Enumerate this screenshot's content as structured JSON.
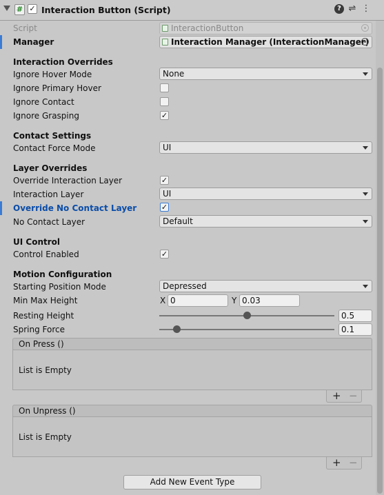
{
  "header": {
    "title": "Interaction Button (Script)",
    "hash": "#",
    "enabled_mark": "✓"
  },
  "script": {
    "label": "Script",
    "value": "InteractionButton"
  },
  "manager": {
    "label": "Manager",
    "value": "Interaction Manager (InteractionManager)"
  },
  "interaction_overrides": {
    "title": "Interaction Overrides",
    "ignore_hover_mode": {
      "label": "Ignore Hover Mode",
      "value": "None"
    },
    "ignore_primary_hover": {
      "label": "Ignore Primary Hover",
      "checked": ""
    },
    "ignore_contact": {
      "label": "Ignore Contact",
      "checked": ""
    },
    "ignore_grasping": {
      "label": "Ignore Grasping",
      "checked": "✓"
    }
  },
  "contact_settings": {
    "title": "Contact Settings",
    "contact_force_mode": {
      "label": "Contact Force Mode",
      "value": "UI"
    }
  },
  "layer_overrides": {
    "title": "Layer Overrides",
    "override_interaction_layer": {
      "label": "Override Interaction Layer",
      "checked": "✓"
    },
    "interaction_layer": {
      "label": "Interaction Layer",
      "value": "UI"
    },
    "override_no_contact_layer": {
      "label": "Override No Contact Layer",
      "checked": "✓"
    },
    "no_contact_layer": {
      "label": "No Contact Layer",
      "value": "Default"
    }
  },
  "ui_control": {
    "title": "UI Control",
    "control_enabled": {
      "label": "Control Enabled",
      "checked": "✓"
    }
  },
  "motion_configuration": {
    "title": "Motion Configuration",
    "starting_position_mode": {
      "label": "Starting Position Mode",
      "value": "Depressed"
    },
    "min_max_height": {
      "label": "Min Max Height",
      "x_label": "X",
      "x_value": "0",
      "y_label": "Y",
      "y_value": "0.03"
    },
    "resting_height": {
      "label": "Resting Height",
      "value": "0.5",
      "fraction": 0.5
    },
    "spring_force": {
      "label": "Spring Force",
      "value": "0.1",
      "fraction": 0.1
    }
  },
  "events": [
    {
      "title": "On Press ()",
      "empty_text": "List is Empty",
      "add": "+",
      "remove": "−"
    },
    {
      "title": "On Unpress ()",
      "empty_text": "List is Empty",
      "add": "+",
      "remove": "−"
    }
  ],
  "add_event_button": "Add New Event Type",
  "colors": {
    "accent": "#3a7bd5",
    "highlight_label": "#0b4da8",
    "background": "#c8c8c8"
  }
}
